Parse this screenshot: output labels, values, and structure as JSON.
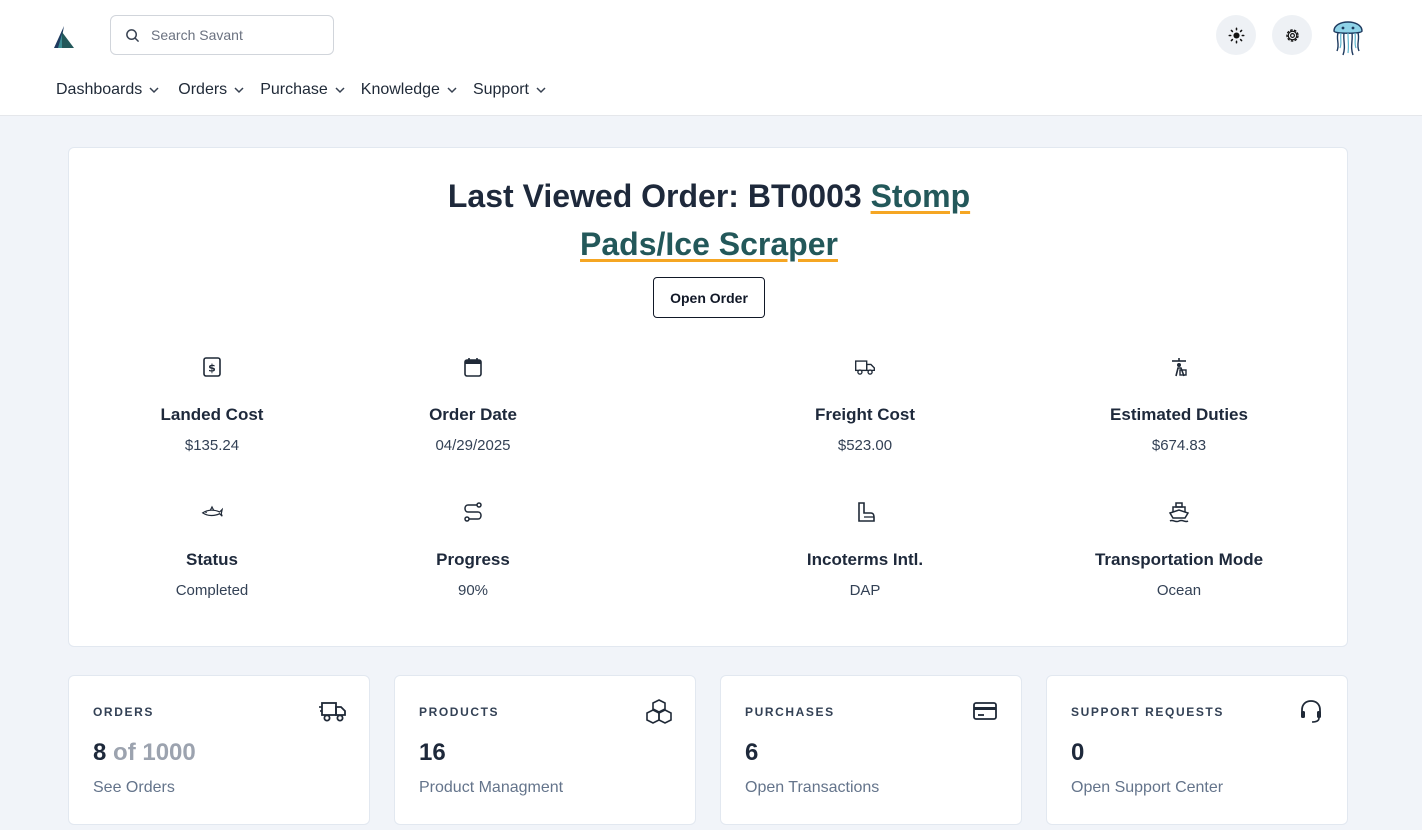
{
  "header": {
    "search": {
      "placeholder": "Search Savant"
    },
    "theme_icon": "sun-icon",
    "settings_icon": "gear-icon",
    "avatar_icon": "jellyfish-avatar"
  },
  "nav": {
    "items": [
      {
        "label": "Dashboards"
      },
      {
        "label": "Orders"
      },
      {
        "label": "Purchase"
      },
      {
        "label": "Knowledge"
      },
      {
        "label": "Support"
      }
    ]
  },
  "order": {
    "title_prefix": "Last Viewed Order: BT0003",
    "product_name": "Stomp Pads/Ice Scraper",
    "open_button": "Open Order",
    "stats": [
      {
        "icon": "dollar-icon",
        "label": "Landed Cost",
        "value": "$135.24"
      },
      {
        "icon": "calendar-icon",
        "label": "Order Date",
        "value": "04/29/2025"
      },
      {
        "icon": "truck-icon",
        "label": "Freight Cost",
        "value": "$523.00"
      },
      {
        "icon": "duties-icon",
        "label": "Estimated Duties",
        "value": "$674.83"
      },
      {
        "icon": "shark-icon",
        "label": "Status",
        "value": "Completed"
      },
      {
        "icon": "route-icon",
        "label": "Progress",
        "value": "90%"
      },
      {
        "icon": "boot-icon",
        "label": "Incoterms Intl.",
        "value": "DAP"
      },
      {
        "icon": "ship-icon",
        "label": "Transportation Mode",
        "value": "Ocean"
      }
    ]
  },
  "summary_cards": [
    {
      "title": "ORDERS",
      "icon": "truck-icon",
      "count": "8",
      "count_suffix": "of 1000",
      "link": "See Orders"
    },
    {
      "title": "PRODUCTS",
      "icon": "boxes-icon",
      "count": "16",
      "count_suffix": "",
      "link": "Product Managment"
    },
    {
      "title": "PURCHASES",
      "icon": "credit-card-icon",
      "count": "6",
      "count_suffix": "",
      "link": "Open Transactions"
    },
    {
      "title": "SUPPORT REQUESTS",
      "icon": "headset-icon",
      "count": "0",
      "count_suffix": "",
      "link": "Open Support Center"
    }
  ],
  "colors": {
    "accent_link": "#23585a",
    "underline": "#f5a623",
    "page_bg": "#f1f4f9"
  }
}
